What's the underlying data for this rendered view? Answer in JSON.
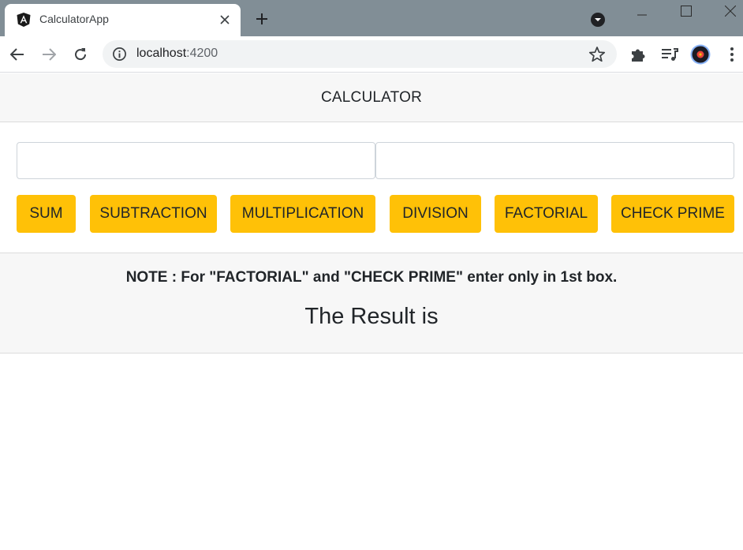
{
  "browser": {
    "tab_title": "CalculatorApp",
    "url_host": "localhost",
    "url_port": ":4200",
    "icons": {
      "favicon": "angular-logo-icon",
      "tab_close": "close-icon",
      "new_tab": "plus-icon",
      "tab_search": "tab-search-icon",
      "back": "back-arrow-icon",
      "forward": "forward-arrow-icon",
      "reload": "reload-icon",
      "site_info": "info-icon",
      "bookmark": "star-icon",
      "extensions": "puzzle-icon",
      "media": "media-queue-icon",
      "profile": "profile-avatar-icon",
      "menu": "kebab-menu-icon"
    },
    "colors": {
      "tabstrip": "#818e96",
      "omnibox": "#f1f3f4"
    }
  },
  "app": {
    "header_title": "CALCULATOR",
    "inputs": {
      "first_value": "",
      "second_value": ""
    },
    "buttons": {
      "sum": "SUM",
      "subtraction": "SUBTRACTION",
      "multiplication": "MULTIPLICATION",
      "division": "DIVISION",
      "factorial": "FACTORIAL",
      "check_prime": "CHECK PRIME"
    },
    "note": "NOTE : For \"FACTORIAL\" and \"CHECK PRIME\" enter only in 1st box.",
    "result_label": "The Result is",
    "colors": {
      "button": "#ffc107",
      "panel": "#f7f7f7",
      "text": "#212529"
    }
  }
}
